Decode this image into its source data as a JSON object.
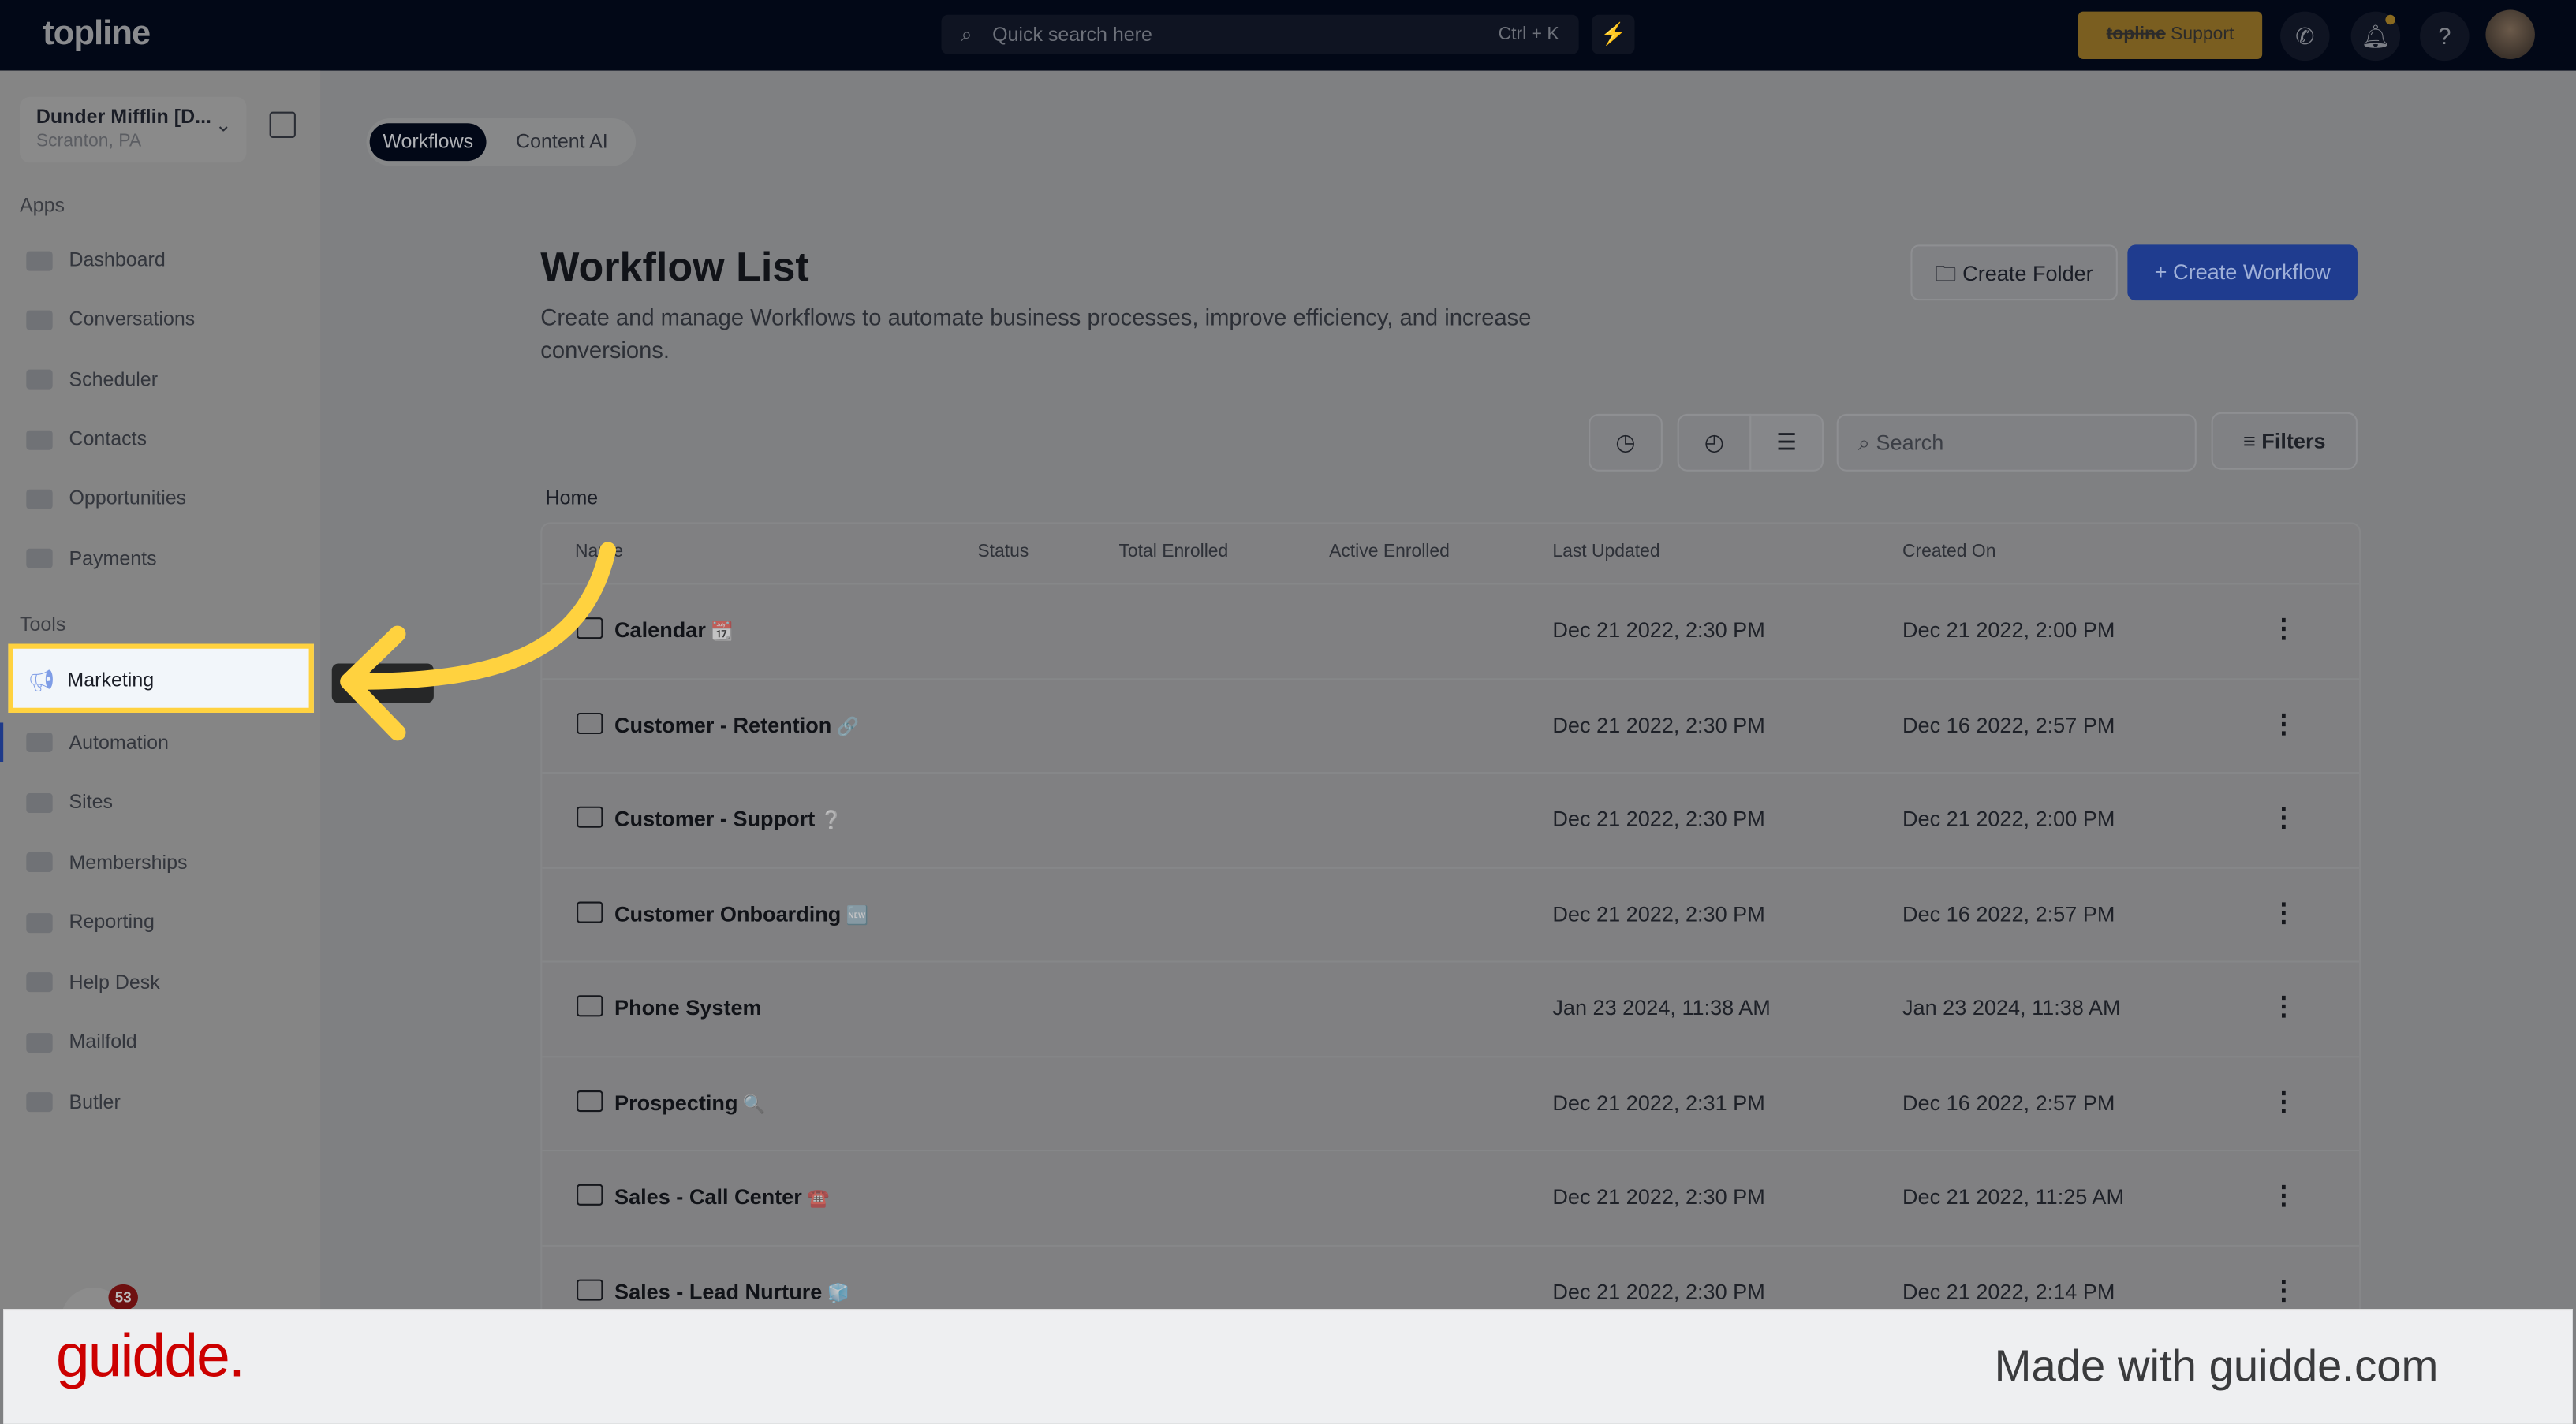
{
  "topbar": {
    "logo": "topline",
    "search_placeholder": "Quick search here",
    "shortcut": "Ctrl + K",
    "support_brand": "topline",
    "support_label": "Support",
    "icons": [
      "search-icon",
      "bolt-icon",
      "phone-icon",
      "bell-icon",
      "help-icon",
      "avatar"
    ]
  },
  "sidebar": {
    "location_name": "Dunder Mifflin [D...",
    "location_sub": "Scranton, PA",
    "apps_label": "Apps",
    "apps": [
      "Dashboard",
      "Conversations",
      "Scheduler",
      "Contacts",
      "Opportunities",
      "Payments"
    ],
    "tools_label": "Tools",
    "tools": [
      "Marketing",
      "Automation",
      "Sites",
      "Memberships",
      "Reporting",
      "Help Desk",
      "Mailfold",
      "Butler"
    ],
    "highlighted": "Marketing",
    "chat_badge": "53"
  },
  "tabs": [
    "Workflows",
    "Content AI"
  ],
  "page": {
    "title": "Workflow List",
    "description": "Create and manage Workflows to automate business processes, improve efficiency, and increase conversions.",
    "create_folder": "Create Folder",
    "create_workflow": "Create Workflow",
    "search_placeholder": "Search",
    "filters": "Filters",
    "breadcrumb": "Home"
  },
  "table": {
    "columns": [
      "Name",
      "Status",
      "Total Enrolled",
      "Active Enrolled",
      "Last Updated",
      "Created On"
    ],
    "rows": [
      {
        "name": "Calendar",
        "emoji": "📆",
        "last_updated": "Dec 21 2022, 2:30 PM",
        "created_on": "Dec 21 2022, 2:00 PM"
      },
      {
        "name": "Customer - Retention",
        "emoji": "🔗",
        "last_updated": "Dec 21 2022, 2:30 PM",
        "created_on": "Dec 16 2022, 2:57 PM"
      },
      {
        "name": "Customer - Support",
        "emoji": "❔",
        "last_updated": "Dec 21 2022, 2:30 PM",
        "created_on": "Dec 21 2022, 2:00 PM"
      },
      {
        "name": "Customer Onboarding",
        "emoji": "🆕",
        "last_updated": "Dec 21 2022, 2:30 PM",
        "created_on": "Dec 16 2022, 2:57 PM"
      },
      {
        "name": "Phone System",
        "emoji": "",
        "last_updated": "Jan 23 2024, 11:38 AM",
        "created_on": "Jan 23 2024, 11:38 AM"
      },
      {
        "name": "Prospecting",
        "emoji": "🔍",
        "last_updated": "Dec 21 2022, 2:31 PM",
        "created_on": "Dec 16 2022, 2:57 PM"
      },
      {
        "name": "Sales - Call Center",
        "emoji": "☎️",
        "last_updated": "Dec 21 2022, 2:30 PM",
        "created_on": "Dec 21 2022, 11:25 AM"
      },
      {
        "name": "Sales - Lead Nurture",
        "emoji": "🧊",
        "last_updated": "Dec 21 2022, 2:30 PM",
        "created_on": "Dec 21 2022, 2:14 PM"
      }
    ]
  },
  "footer": {
    "logo": "guidde.",
    "made_with": "Made with guidde.com"
  },
  "colors": {
    "highlight": "#ffd23f",
    "primary": "#1f3c8f",
    "brand_red": "#cc0000"
  }
}
